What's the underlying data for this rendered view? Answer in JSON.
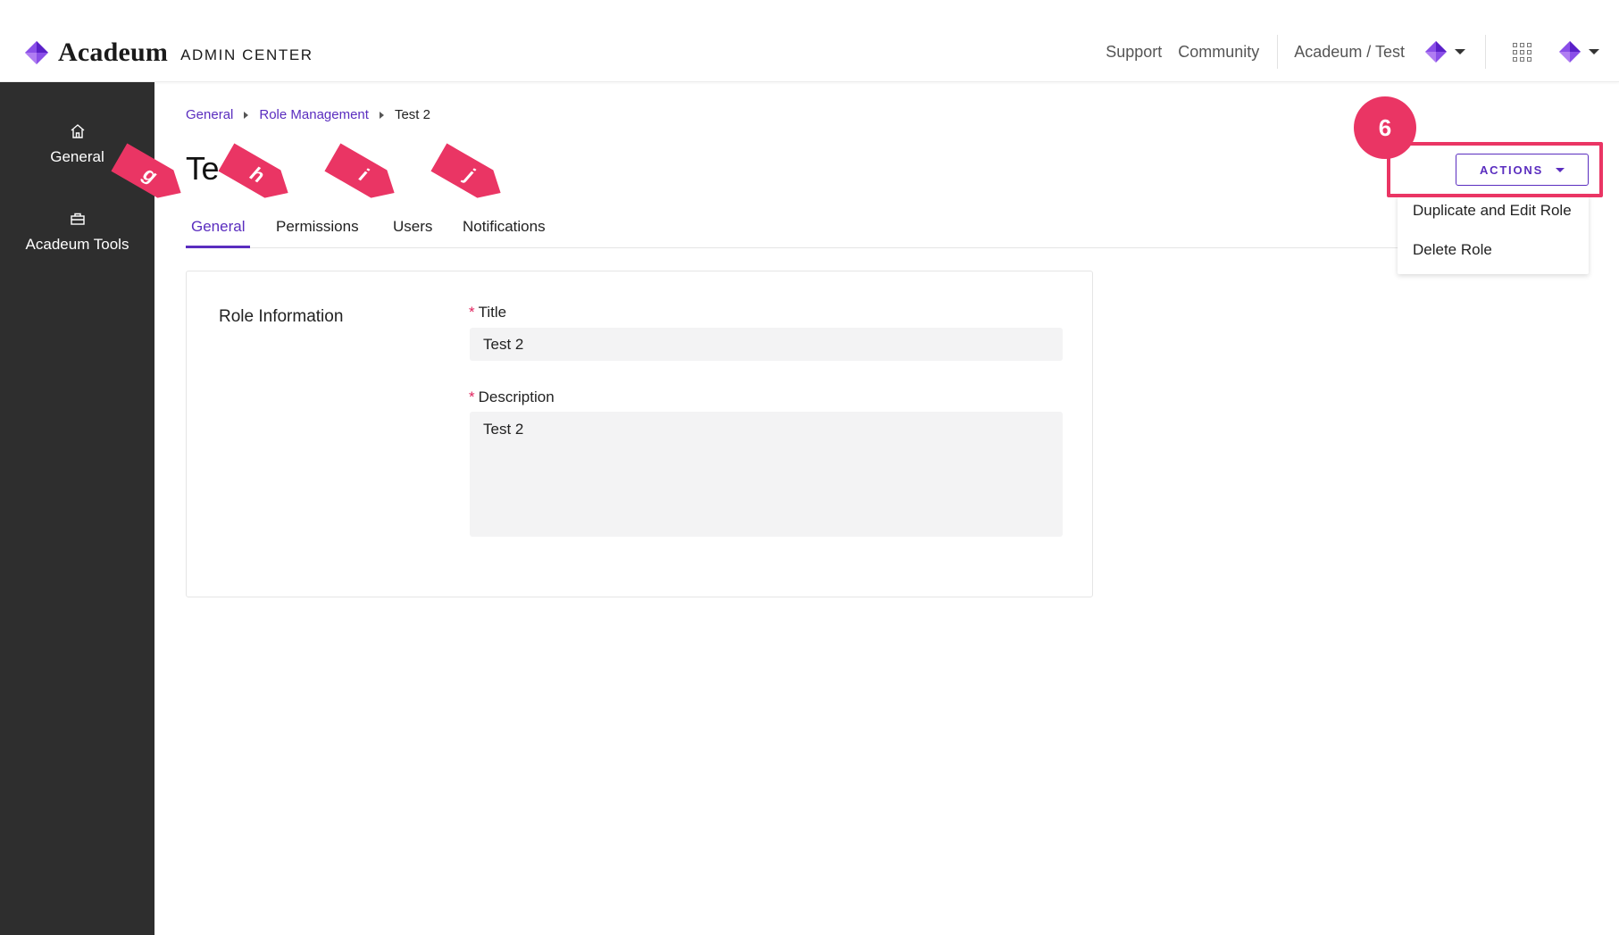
{
  "header": {
    "brand_name": "Acadeum",
    "brand_sub": "ADMIN CENTER",
    "links": [
      "Support",
      "Community"
    ],
    "tenant": "Acadeum / Test",
    "brand_color": "#6a2fd6"
  },
  "sidebar": {
    "items": [
      {
        "label": "General",
        "icon": "home-icon"
      },
      {
        "label": "Acadeum Tools",
        "icon": "toolbox-icon"
      }
    ]
  },
  "breadcrumb": [
    "General",
    "Role Management",
    "Test 2"
  ],
  "page": {
    "title_visible": "Te"
  },
  "tabs": [
    "General",
    "Permissions",
    "Users",
    "Notifications"
  ],
  "role_information": {
    "heading": "Role Information",
    "title_label": "Title",
    "title_value": "Test 2",
    "description_label": "Description",
    "description_value": "Test 2",
    "required_marker": "*"
  },
  "actions": {
    "button_label": "ACTIONS",
    "menu": [
      "Duplicate and Edit Role",
      "Delete Role"
    ]
  },
  "annotations": {
    "step_number": "6",
    "tags": [
      "g",
      "h",
      "i",
      "j"
    ],
    "accent_color": "#ea3564"
  }
}
